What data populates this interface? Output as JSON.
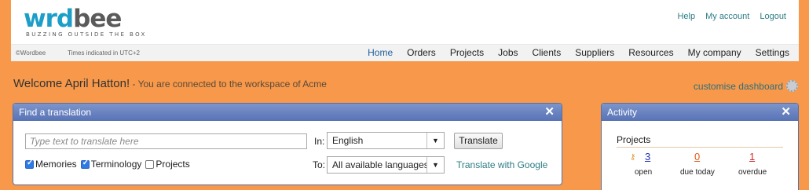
{
  "header": {
    "logo_text_1": "w",
    "logo_text_2": "rd",
    "logo_text_3": "bee",
    "logo_tagline": "BUZZING OUTSIDE THE BOX",
    "links": [
      "Help",
      "My account",
      "Logout"
    ],
    "copyright": "©Wordbee",
    "timezone": "Times indicated in UTC+2",
    "nav": [
      "Home",
      "Orders",
      "Projects",
      "Jobs",
      "Clients",
      "Suppliers",
      "Resources",
      "My company",
      "Settings"
    ],
    "active_nav": "Home"
  },
  "welcome": {
    "name": "Welcome April Hatton!",
    "subtitle": " - You are connected to the workspace of Acme",
    "customise": "customise dashboard"
  },
  "translate_panel": {
    "title": "Find a translation",
    "close": "✕",
    "search_placeholder": "Type text to translate here",
    "in_label": "In:",
    "to_label": "To:",
    "source_language": "English",
    "target_language": "All available languages",
    "translate_button": "Translate",
    "google_link": "Translate with Google",
    "checkboxes": [
      {
        "label": "Memories",
        "checked": true
      },
      {
        "label": "Terminology",
        "checked": true
      },
      {
        "label": "Projects",
        "checked": false
      }
    ]
  },
  "activity_panel": {
    "title": "Activity",
    "close": "✕",
    "section": "Projects",
    "open_count": "3",
    "open_label": "open",
    "due_count": "0",
    "due_label": "due today",
    "overdue_count": "1",
    "overdue_label": "overdue"
  },
  "colors": {
    "background": "#f7984a",
    "panel_header": "#6a83c1",
    "link": "#2e7d86",
    "logo_blue": "#1d9ec9"
  },
  "icons": [
    "close-icon",
    "gear-icon",
    "dropdown-arrow-icon",
    "key-icon",
    "checkbox-checked-icon"
  ]
}
